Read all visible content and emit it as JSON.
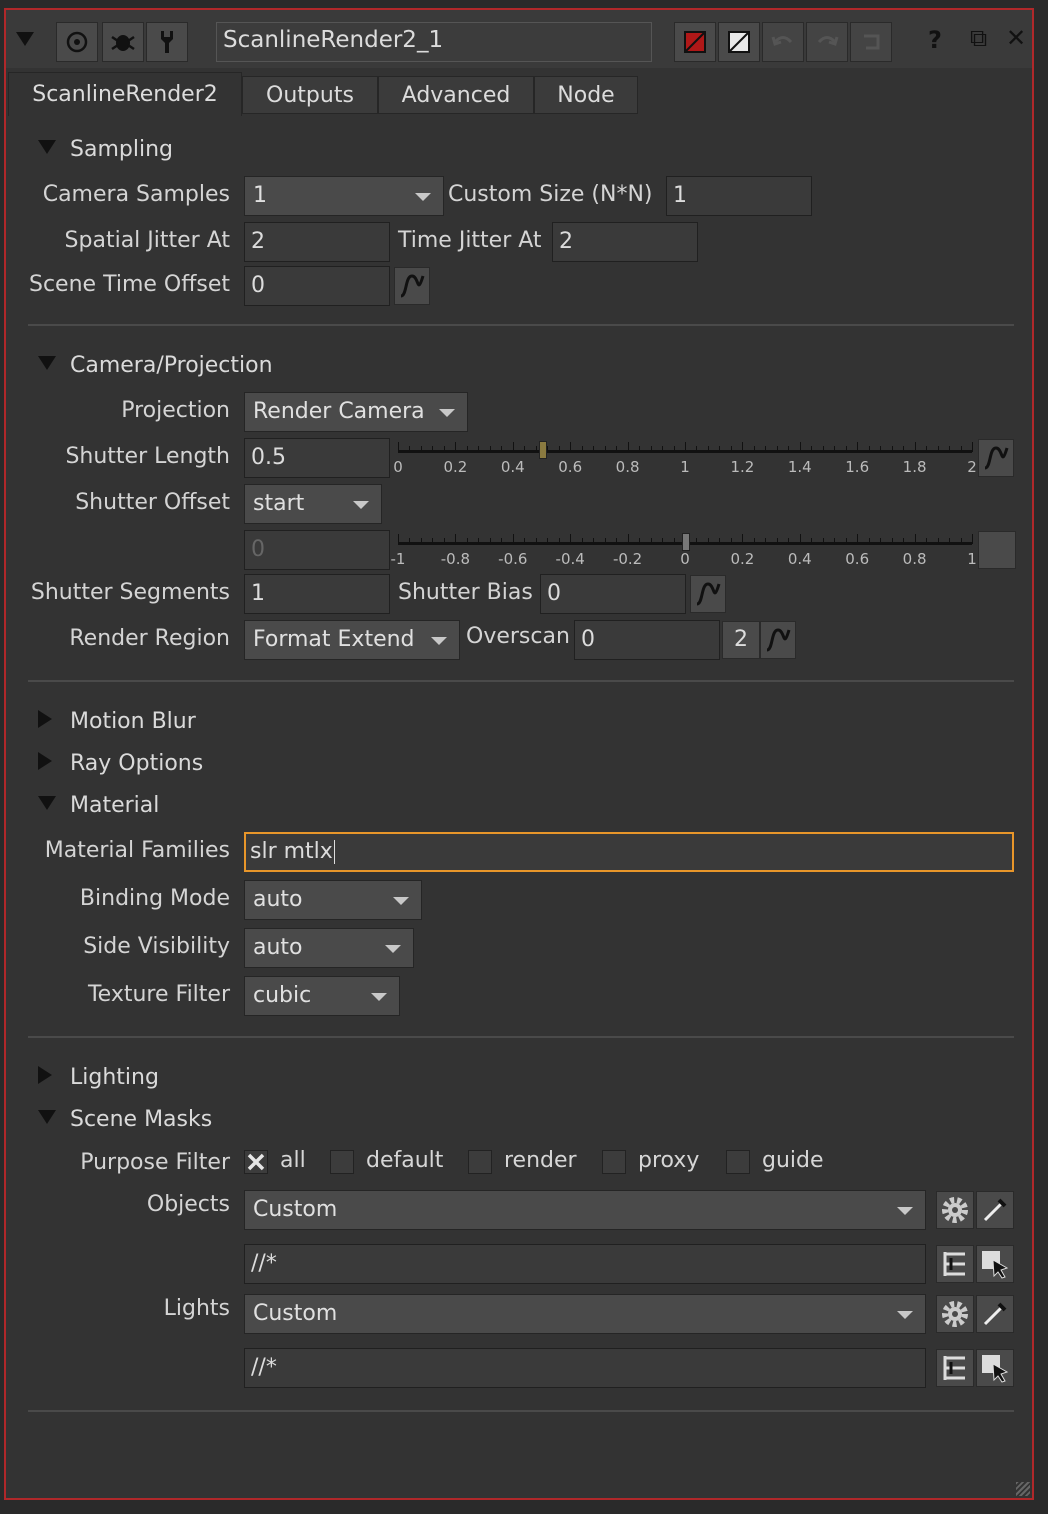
{
  "window": {
    "node_name": "ScanlineRender2_1",
    "help": "?",
    "float": "⧉",
    "close": "✕"
  },
  "tabs": [
    "ScanlineRender2",
    "Outputs",
    "Advanced",
    "Node"
  ],
  "sampling": {
    "title": "Sampling",
    "camera_samples_label": "Camera Samples",
    "camera_samples_value": "1",
    "custom_size_label": "Custom Size (N*N)",
    "custom_size_value": "1",
    "spatial_jitter_label": "Spatial Jitter At",
    "spatial_jitter_value": "2",
    "time_jitter_label": "Time Jitter At",
    "time_jitter_value": "2",
    "scene_time_offset_label": "Scene Time Offset",
    "scene_time_offset_value": "0"
  },
  "camera": {
    "title": "Camera/Projection",
    "projection_label": "Projection",
    "projection_value": "Render Camera",
    "shutter_length_label": "Shutter Length",
    "shutter_length_value": "0.5",
    "shutter_length_slider": {
      "min": 0,
      "max": 2,
      "value": 0.5,
      "ticks": [
        "0",
        "0.2",
        "0.4",
        "0.6",
        "0.8",
        "1",
        "1.2",
        "1.4",
        "1.6",
        "1.8",
        "2"
      ]
    },
    "shutter_offset_label": "Shutter Offset",
    "shutter_offset_value": "start",
    "custom_offset_value": "0",
    "custom_offset_slider": {
      "min": -1,
      "max": 1,
      "value": 0,
      "ticks": [
        "-1",
        "-0.8",
        "-0.6",
        "-0.4",
        "-0.2",
        "0",
        "0.2",
        "0.4",
        "0.6",
        "0.8",
        "1"
      ]
    },
    "shutter_segments_label": "Shutter Segments",
    "shutter_segments_value": "1",
    "shutter_bias_label": "Shutter Bias",
    "shutter_bias_value": "0",
    "render_region_label": "Render Region",
    "render_region_value": "Format Extend",
    "overscan_label": "Overscan",
    "overscan_value": "0",
    "overscan_dim": "2"
  },
  "collapsed": {
    "motion_blur": "Motion Blur",
    "ray_options": "Ray Options"
  },
  "material": {
    "title": "Material",
    "families_label": "Material Families",
    "families_value": "slr mtlx",
    "binding_label": "Binding Mode",
    "binding_value": "auto",
    "side_label": "Side Visibility",
    "side_value": "auto",
    "texture_label": "Texture Filter",
    "texture_value": "cubic"
  },
  "lighting": {
    "title": "Lighting"
  },
  "masks": {
    "title": "Scene Masks",
    "purpose_label": "Purpose Filter",
    "purposes": [
      {
        "label": "all",
        "checked": true
      },
      {
        "label": "default",
        "checked": false
      },
      {
        "label": "render",
        "checked": false
      },
      {
        "label": "proxy",
        "checked": false
      },
      {
        "label": "guide",
        "checked": false
      }
    ],
    "objects_label": "Objects",
    "objects_mode": "Custom",
    "objects_pattern": "//*",
    "lights_label": "Lights",
    "lights_mode": "Custom",
    "lights_pattern": "//*"
  },
  "colors": {
    "accent": "#e8962a",
    "border": "#b0282a"
  }
}
